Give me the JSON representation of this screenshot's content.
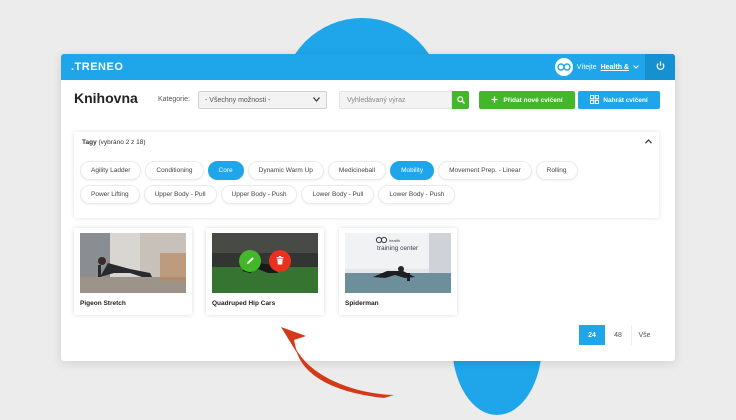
{
  "brand": {
    "logo": ".TRENEO"
  },
  "user": {
    "greeting": "Vítejte",
    "name": "Health &"
  },
  "header": {
    "title": "Knihovna",
    "category_label": "Kategorie:",
    "category_value": "- Všechny možnosti -",
    "search_placeholder": "Vyhledávaný výraz",
    "add_button": "Přidat nové cvičení",
    "upload_button": "Nahrát cvičení"
  },
  "tags": {
    "title": "Tagy",
    "subtitle": "(vybráno 2 z 18)",
    "row1": [
      "Agility Ladder",
      "Conditioning",
      "Core",
      "Dynamic Warm Up",
      "Medicineball",
      "Mobility",
      "Movement Prep. - Linear",
      "Rolling"
    ],
    "row2": [
      "Power Lifting",
      "Upper Body - Pull",
      "Upper Body - Push",
      "Lower Body - Pull",
      "Lower Body - Push"
    ]
  },
  "cards": [
    {
      "title": "Pigeon Stretch"
    },
    {
      "title": "Quadruped Hip Cars"
    },
    {
      "title": "Spiderman",
      "thumb_sign_small": "health",
      "thumb_sign": "training center"
    }
  ],
  "pagination": {
    "options": [
      "24",
      "48",
      "Vše"
    ]
  },
  "colors": {
    "primary": "#1fa6ea",
    "green": "#42b72a",
    "red": "#e8321e",
    "arrow": "#d43a1a"
  }
}
